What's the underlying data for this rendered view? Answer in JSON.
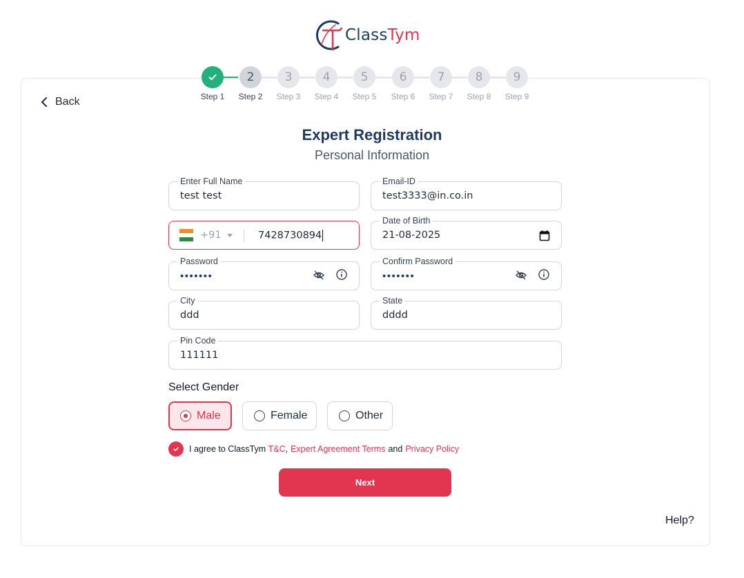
{
  "brand": {
    "name_part1": "Class",
    "name_part2": "Tym",
    "logo_icon": "classtym-logo-icon",
    "primary_color": "#e2354f",
    "navy_color": "#1e3a5f"
  },
  "stepper": {
    "steps": [
      {
        "number": "",
        "label": "Step 1",
        "state": "done"
      },
      {
        "number": "2",
        "label": "Step 2",
        "state": "current"
      },
      {
        "number": "3",
        "label": "Step 3",
        "state": "pending"
      },
      {
        "number": "4",
        "label": "Step 4",
        "state": "pending"
      },
      {
        "number": "5",
        "label": "Step 5",
        "state": "pending"
      },
      {
        "number": "6",
        "label": "Step 6",
        "state": "pending"
      },
      {
        "number": "7",
        "label": "Step 7",
        "state": "pending"
      },
      {
        "number": "8",
        "label": "Step 8",
        "state": "pending"
      },
      {
        "number": "9",
        "label": "Step 9",
        "state": "pending"
      }
    ],
    "done_color": "#22b07d"
  },
  "nav": {
    "back_label": "Back",
    "back_icon": "chevron-left-icon"
  },
  "header": {
    "title": "Expert Registration",
    "subtitle": "Personal Information"
  },
  "form": {
    "full_name": {
      "label": "Enter Full Name",
      "value": "test test"
    },
    "email": {
      "label": "Email-ID",
      "value": "test3333@in.co.in"
    },
    "phone": {
      "country_code": "+91",
      "flag_icon": "india-flag-icon",
      "value": "7428730894"
    },
    "dob": {
      "label": "Date of Birth",
      "value": "21-08-2025",
      "icon": "calendar-icon"
    },
    "password": {
      "label": "Password",
      "value": "•••••••",
      "icons": [
        "eye-off-icon",
        "info-icon"
      ]
    },
    "confirm_password": {
      "label": "Confirm Password",
      "value": "•••••••",
      "icons": [
        "eye-off-icon",
        "info-icon"
      ]
    },
    "city": {
      "label": "City",
      "value": "ddd"
    },
    "state": {
      "label": "State",
      "value": "dddd"
    },
    "pin_code": {
      "label": "Pin Code",
      "value": "111111"
    }
  },
  "gender": {
    "label": "Select Gender",
    "options": [
      {
        "label": "Male",
        "selected": true
      },
      {
        "label": "Female",
        "selected": false
      },
      {
        "label": "Other",
        "selected": false
      }
    ]
  },
  "agreement": {
    "checked": true,
    "prefix": "I agree to ClassTym ",
    "tc_link": "T&C",
    "comma": ",",
    "expert_link": "Expert Agreement Terms",
    "and_text": "and",
    "privacy_link": "Privacy Policy"
  },
  "actions": {
    "next_label": "Next",
    "help_label": "Help?"
  }
}
